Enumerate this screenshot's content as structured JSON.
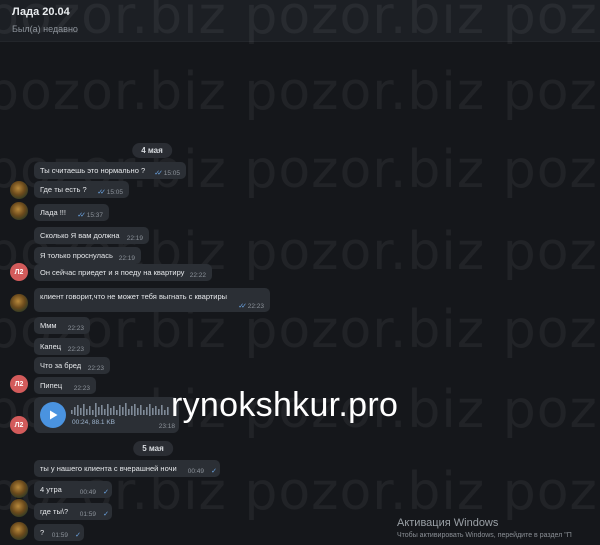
{
  "header": {
    "name": "Лада 20.04",
    "status": "Был(а) недавно"
  },
  "watermark": "pozor.biz   pozor.biz   pozor.biz   pozor.biz",
  "dates": {
    "d1": "4 мая",
    "d2": "5 мая"
  },
  "avatars": {
    "initials": "Л2"
  },
  "messages": [
    {
      "text": "Ты считаешь это нормально ?",
      "time": "15:05"
    },
    {
      "text": "Где ты есть ?",
      "time": "15:05"
    },
    {
      "text": "Лада !!!",
      "time": "15:37"
    },
    {
      "text": "Сколько Я вам должна",
      "time": "22:19"
    },
    {
      "text": "Я только проснулась",
      "time": "22:19"
    },
    {
      "text": "Он сейчас приедет и я поеду на квартиру",
      "time": "22:22"
    },
    {
      "text": "клиент говорит,что не может тебя выгнать с квартиры",
      "time": "22:23"
    },
    {
      "text": "Ммм",
      "time": "22:23"
    },
    {
      "text": "Капец",
      "time": "22:23"
    },
    {
      "text": "Что за бред",
      "time": "22:23"
    },
    {
      "text": "Пипец",
      "time": "22:23"
    },
    {
      "text": "ты у нашего клиента с вчерашней ночи",
      "time": "00:49"
    },
    {
      "text": "4 утра",
      "time": "00:49"
    },
    {
      "text": "где ты\\?",
      "time": "01:59"
    },
    {
      "text": "?",
      "time": "01:59"
    }
  ],
  "voice": {
    "meta": "00:24, 88.1 KB",
    "time": "23:18"
  },
  "overlay": {
    "url": "rynokshkur.pro"
  },
  "windows": {
    "title": "Активация Windows",
    "subtitle": "Чтобы активировать Windows, перейдите в раздел \"П"
  },
  "colors": {
    "accent": "#4a93e0",
    "bubble": "#2b2f35",
    "background": "#15171b",
    "initials_avatar": "#d35b5b"
  }
}
